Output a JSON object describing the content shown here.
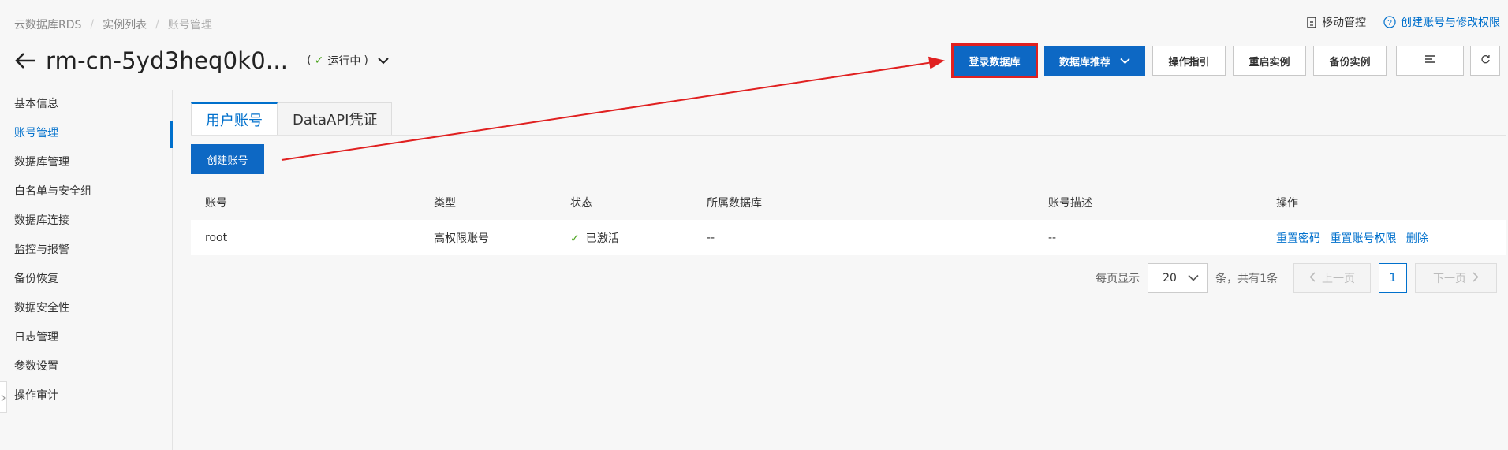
{
  "breadcrumb": {
    "items": [
      "云数据库RDS",
      "实例列表",
      "账号管理"
    ]
  },
  "header": {
    "instance_name": "rm-cn-5yd3heq0k0...",
    "status_prefix": "(",
    "status_text": "运行中",
    "status_suffix": ")",
    "mobile_label": "移动管控",
    "help_label": "创建账号与修改权限"
  },
  "actions": {
    "login_db": "登录数据库",
    "db_recommend": "数据库推荐",
    "guide": "操作指引",
    "restart": "重启实例",
    "backup": "备份实例"
  },
  "sidebar": {
    "items": [
      {
        "label": "基本信息"
      },
      {
        "label": "账号管理"
      },
      {
        "label": "数据库管理"
      },
      {
        "label": "白名单与安全组"
      },
      {
        "label": "数据库连接"
      },
      {
        "label": "监控与报警"
      },
      {
        "label": "备份恢复"
      },
      {
        "label": "数据安全性"
      },
      {
        "label": "日志管理"
      },
      {
        "label": "参数设置"
      },
      {
        "label": "操作审计"
      }
    ],
    "active_index": 1
  },
  "tabs": [
    {
      "label": "用户账号"
    },
    {
      "label": "DataAPI凭证"
    }
  ],
  "create_account": "创建账号",
  "table": {
    "headers": [
      "账号",
      "类型",
      "状态",
      "所属数据库",
      "账号描述",
      "操作"
    ],
    "rows": [
      {
        "account": "root",
        "type": "高权限账号",
        "status": "已激活",
        "database": "--",
        "description": "--",
        "ops": [
          "重置密码",
          "重置账号权限",
          "删除"
        ]
      }
    ]
  },
  "pagination": {
    "per_page_label": "每页显示",
    "page_size": "20",
    "total_text": "条，共有1条",
    "prev": "上一页",
    "next": "下一页",
    "current_page": "1"
  },
  "colors": {
    "accent": "#0070cc",
    "primary_button": "#0d68c4",
    "annotation_red": "#e02020",
    "success": "#4ba41e"
  }
}
